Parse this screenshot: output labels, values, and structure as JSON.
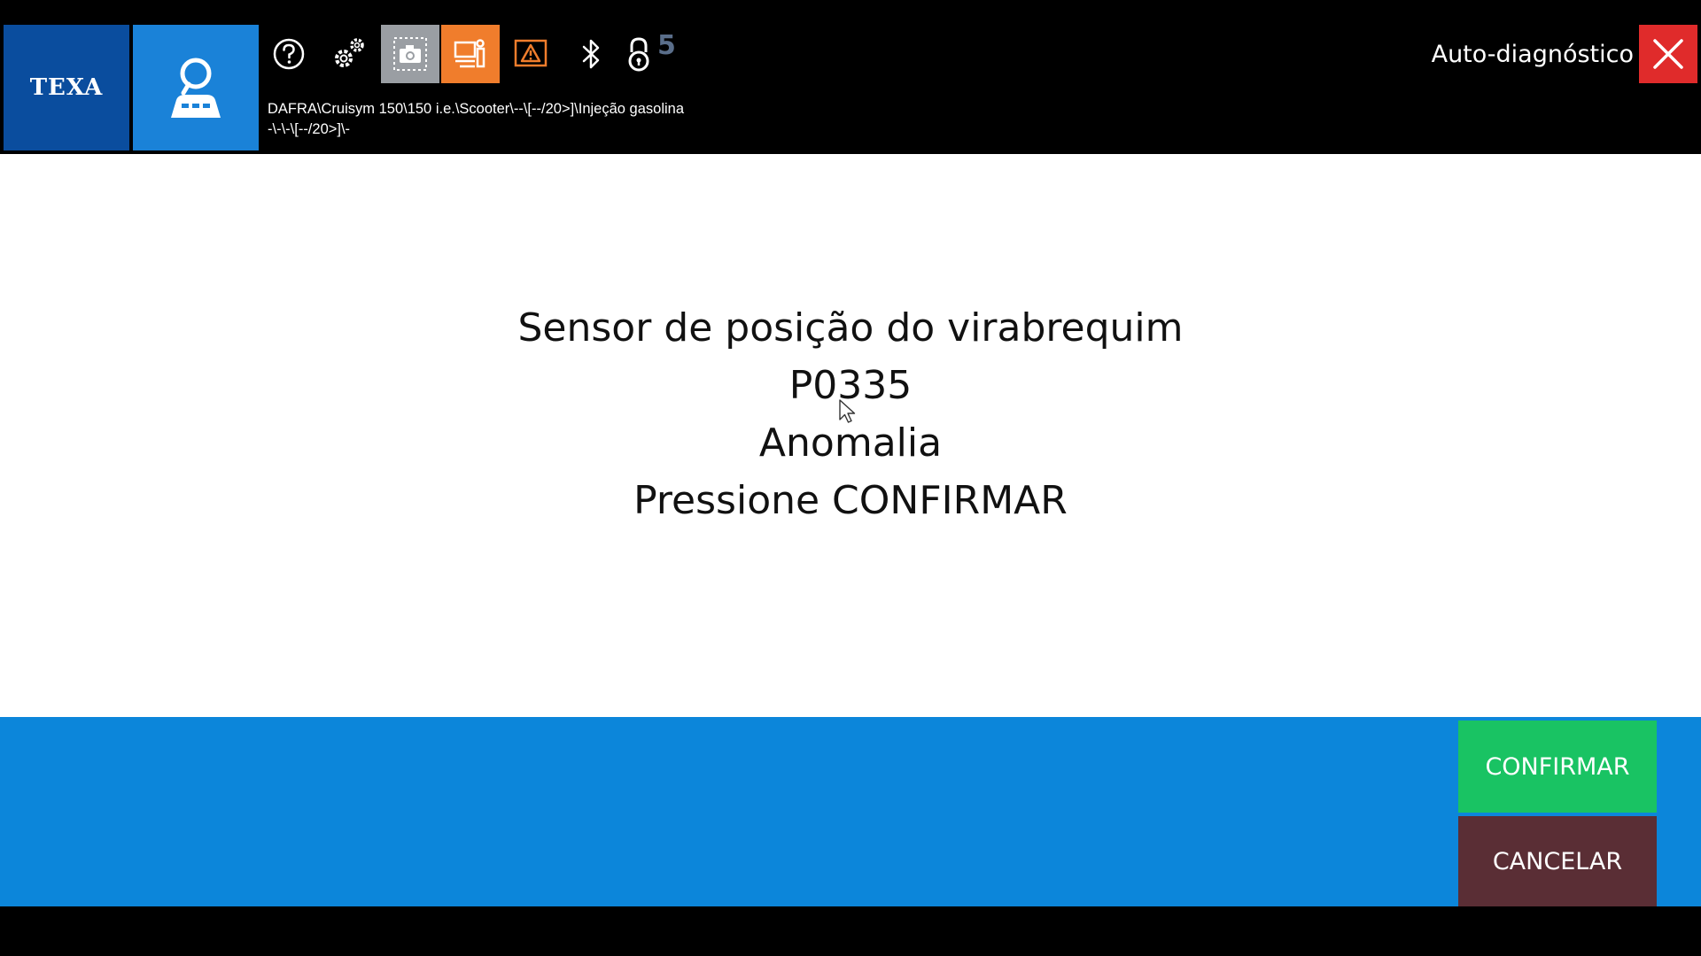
{
  "header": {
    "logo_text": "TEXA",
    "app_icon": "vehicle-diagnosis-icon",
    "breadcrumb_line1": "DAFRA\\Cruisym 150\\150 i.e.\\Scooter\\--\\[--/20>]\\Injeção gasolina",
    "breadcrumb_line2": "-\\-\\-\\[--/20>]\\-",
    "title": "Auto-diagnóstico",
    "badge_count": "5",
    "toolbar_icons": [
      "help-icon",
      "settings-icon",
      "screenshot-icon",
      "device-info-icon",
      "warning-icon",
      "bluetooth-icon",
      "lock-icon"
    ]
  },
  "message": {
    "line1": "Sensor de posição do virabrequim",
    "line2": "P0335",
    "line3": "Anomalia",
    "line4": "Pressione CONFIRMAR"
  },
  "actions": {
    "confirm_label": "CONFIRMAR",
    "cancel_label": "CANCELAR"
  },
  "colors": {
    "logo_bg": "#0a4d9e",
    "app_tile_bg": "#1a82d8",
    "bottom_bar": "#0c86da",
    "confirm": "#19c363",
    "cancel": "#5a2e35",
    "close": "#e02b2b",
    "orange_tool": "#f07d2c"
  }
}
